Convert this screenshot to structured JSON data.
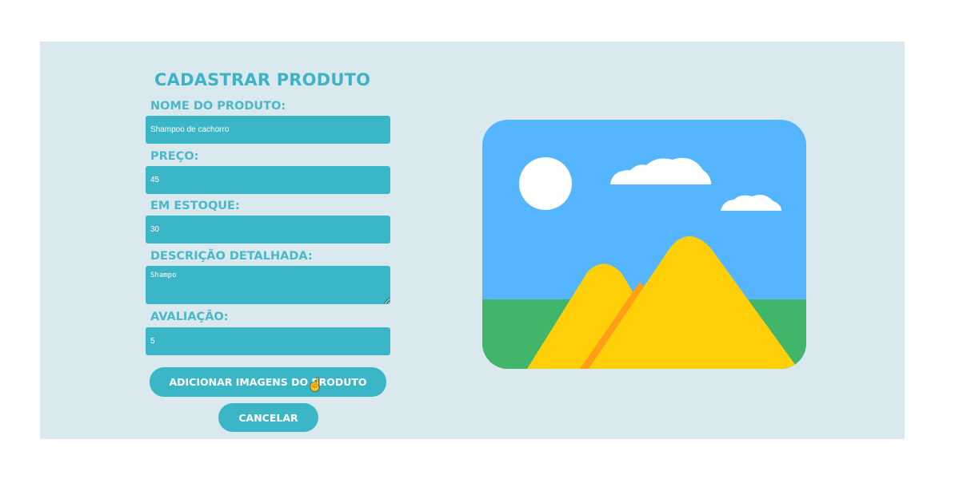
{
  "form": {
    "title": "CADASTRAR PRODUTO",
    "fields": [
      {
        "label": "NOME DO PRODUTO:",
        "value": "Shampoo de cachorro"
      },
      {
        "label": "PREÇO:",
        "value": "45"
      },
      {
        "label": "EM ESTOQUE:",
        "value": "30"
      },
      {
        "label": "DESCRIÇÃO DETALHADA:",
        "value": "Shampo"
      },
      {
        "label": "AVALIAÇÃO:",
        "value": "5"
      }
    ],
    "add_images_label": "ADICIONAR IMAGENS DO PRODUTO",
    "cancel_label": "CANCELAR"
  },
  "colors": {
    "accent": "#3bb6c6",
    "panel_bg": "#d9e9ee",
    "sky": "#55b5ff",
    "grass": "#41b56a",
    "mountain": "#ffcf0a",
    "mountain_shadow": "#ff9e17"
  },
  "icons": [
    "image-placeholder-icon",
    "pointer-cursor-icon"
  ]
}
